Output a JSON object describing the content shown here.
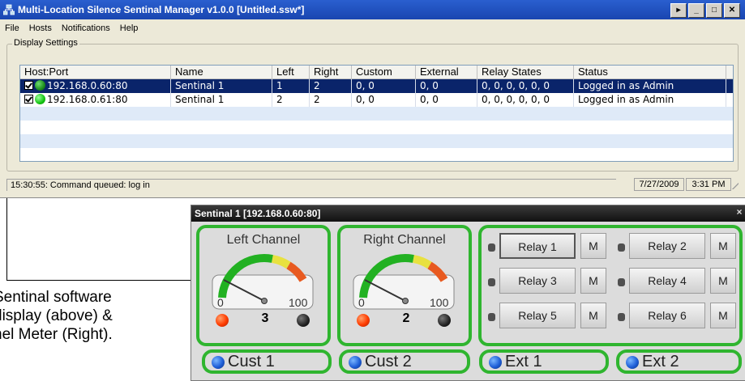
{
  "window": {
    "title": "Multi-Location Silence Sentinal Manager v1.0.0 [Untitled.ssw*]",
    "buttons": [
      "▸",
      "_",
      "□",
      "✕"
    ]
  },
  "menu": [
    "File",
    "Hosts",
    "Notifications",
    "Help"
  ],
  "display_settings": {
    "legend": "Display Settings",
    "columns": [
      "Host:Port",
      "Name",
      "Left",
      "Right",
      "Custom",
      "External",
      "Relay States",
      "Status"
    ],
    "rows": [
      {
        "host": "192.168.0.60:80",
        "name": "Sentinal 1",
        "left": "1",
        "right": "2",
        "custom": "0, 0",
        "external": "0, 0",
        "relays": "0, 0, 0, 0, 0, 0",
        "status": "Logged in as Admin",
        "checked": true,
        "selected": true
      },
      {
        "host": "192.168.0.61:80",
        "name": "Sentinal 1",
        "left": "2",
        "right": "2",
        "custom": "0, 0",
        "external": "0, 0",
        "relays": "0, 0, 0, 0, 0, 0",
        "status": "Logged in as Admin",
        "checked": true,
        "selected": false
      }
    ]
  },
  "statusbar": {
    "message": "15:30:55: Command queued: log in",
    "date": "7/27/2009",
    "time": "3:31 PM"
  },
  "caption": {
    "line1": "Sentinal software",
    "line2": "display (above) &",
    "line3": "nel Meter (Right)."
  },
  "meter": {
    "title": "Sentinal 1 [192.168.0.60:80]",
    "close": "×",
    "left_channel": {
      "label": "Left Channel",
      "min": "0",
      "max": "100",
      "peak": "3"
    },
    "right_channel": {
      "label": "Right Channel",
      "min": "0",
      "max": "100",
      "peak": "2"
    },
    "relays": [
      {
        "label": "Relay 1",
        "mode": "M"
      },
      {
        "label": "Relay 2",
        "mode": "M"
      },
      {
        "label": "Relay 3",
        "mode": "M"
      },
      {
        "label": "Relay 4",
        "mode": "M"
      },
      {
        "label": "Relay 5",
        "mode": "M"
      },
      {
        "label": "Relay 6",
        "mode": "M"
      }
    ],
    "inputs": [
      "Cust 1",
      "Cust 2",
      "Ext 1",
      "Ext 2"
    ]
  },
  "colors": {
    "accent": "#2fb52f",
    "selection": "#0a246a",
    "titlebar": "#1945b0"
  }
}
